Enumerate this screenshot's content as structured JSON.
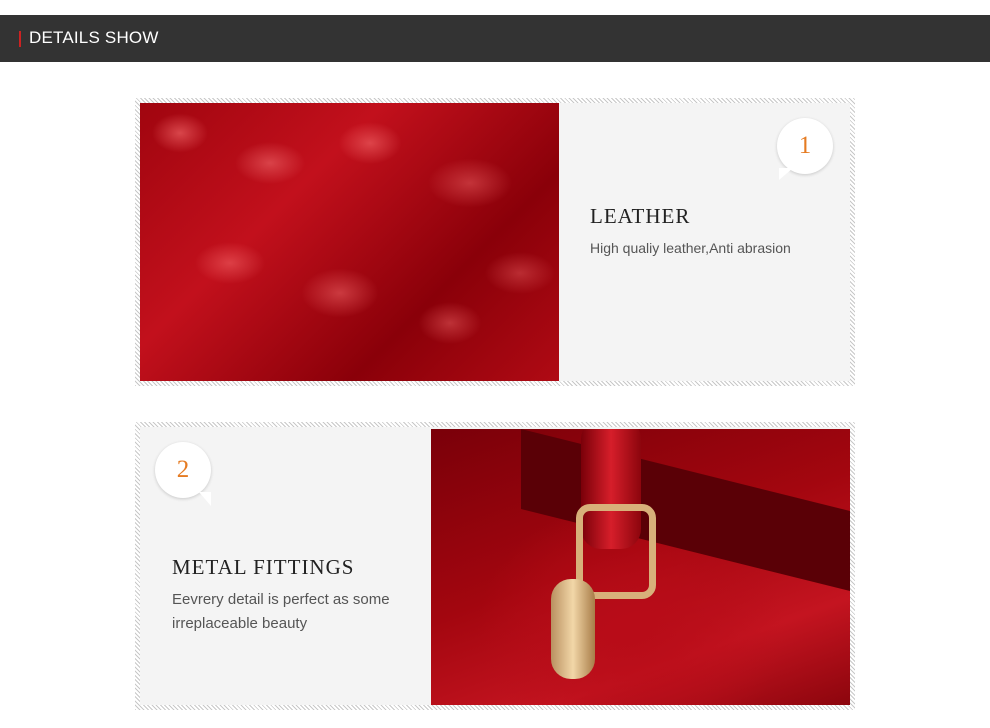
{
  "header": {
    "title": "DETAILS SHOW",
    "accent_color": "#cc2222"
  },
  "features": [
    {
      "number": "1",
      "title": "LEATHER",
      "description": "High qualiy leather,Anti abrasion",
      "image": "red crocodile-embossed patent leather close-up"
    },
    {
      "number": "2",
      "title": "METAL FITTINGS",
      "description": "Eevrery detail is perfect as some irreplaceable beauty",
      "image": "red handbag handle with gold metal clasp"
    }
  ],
  "colors": {
    "number_color": "#e57b22",
    "header_bg": "#333333"
  }
}
